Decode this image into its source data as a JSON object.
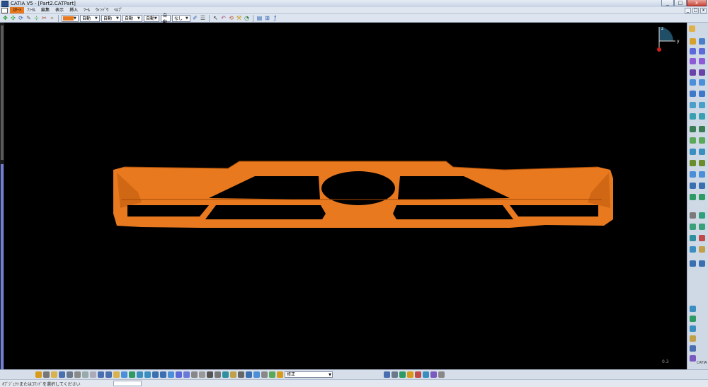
{
  "window": {
    "title": "CATIA V5 - [Part2.CATPart]",
    "buttons": [
      "_",
      "□",
      "x"
    ]
  },
  "menu": {
    "items": [
      "ｽﾀｰﾄ",
      "ﾌｧｲﾙ",
      "編集",
      "表示",
      "挿入",
      "ﾂｰﾙ",
      "ｳｨﾝﾄﾞｳ",
      "ﾍﾙﾌﾟ"
    ],
    "active_index": 0
  },
  "toolbar": {
    "fill_color": "#e8791f",
    "dropdowns": [
      "自動",
      "自動",
      "自動",
      "自動",
      "自動",
      "なし"
    ]
  },
  "viewport": {
    "background": "#000000",
    "part_color": "#e8791f",
    "compass_axes": [
      "z",
      "y"
    ],
    "scale_text": "0.3"
  },
  "bottom_toolbar": {
    "filter_combo": "修正"
  },
  "status": {
    "message": "ｵﾌﾞｼﾞｪｸﾄまたはｺﾏﾝﾄﾞを選択してください"
  },
  "brand": {
    "name": "CATIA"
  }
}
